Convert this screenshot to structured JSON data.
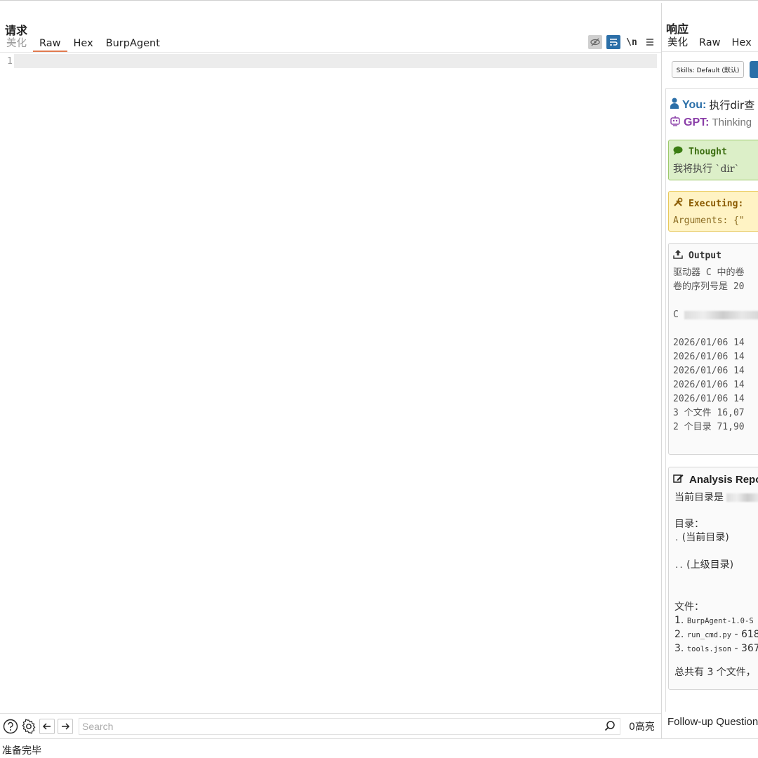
{
  "request": {
    "title": "请求",
    "tabs": [
      {
        "label": "美化",
        "state": "muted"
      },
      {
        "label": "Raw",
        "state": "active"
      },
      {
        "label": "Hex",
        "state": "normal"
      },
      {
        "label": "BurpAgent",
        "state": "normal"
      }
    ],
    "tools": {
      "hide_icon": "eye-slash-icon",
      "wrap_icon": "wrap-text-icon",
      "newline_label": "\\n",
      "menu_icon": "hamburger-menu-icon"
    },
    "editor": {
      "line_number": "1",
      "content": ""
    }
  },
  "search_bar": {
    "help_icon": "question-circle-icon",
    "settings_icon": "gear-icon",
    "back_icon": "arrow-left-icon",
    "forward_icon": "arrow-right-icon",
    "placeholder": "Search",
    "match_count": "0高亮"
  },
  "status": {
    "text": "准备完毕"
  },
  "response": {
    "title": "响应",
    "tabs": [
      {
        "label": "美化",
        "state": "normal"
      },
      {
        "label": "Raw",
        "state": "normal"
      },
      {
        "label": "Hex",
        "state": "normal"
      }
    ],
    "skills_button": "Skills: Default (默认)",
    "chat": {
      "you_label": "You:",
      "you_text": "执行dir查",
      "gpt_label": "GPT:",
      "gpt_text": "Thinking",
      "thought": {
        "title": "Thought",
        "body": "我将执行 `dir`"
      },
      "executing": {
        "title": "Executing:",
        "body": "Arguments: {\""
      },
      "output": {
        "title": "Output",
        "lines": [
          "驱动器 C 中的卷",
          "卷的序列号是 20",
          "",
          "C",
          "",
          "2026/01/06 14",
          "2026/01/06 14",
          "2026/01/06 14",
          "2026/01/06 14",
          "2026/01/06 14",
          "3 个文件 16,07",
          "2 个目录 71,90"
        ]
      },
      "report": {
        "title": "Analysis Repo",
        "current_dir": "当前目录是",
        "dirs_title": "目录：",
        "dir_items": [
          {
            "code": ".",
            "desc": "(当前目录)"
          },
          {
            "code": "..",
            "desc": "(上级目录)"
          }
        ],
        "files_title": "文件：",
        "file_items": [
          {
            "num": "1.",
            "name": "BurpAgent-1.0-S",
            "size": ""
          },
          {
            "num": "2.",
            "name": "run_cmd.py",
            "size": " - 618"
          },
          {
            "num": "3.",
            "name": "tools.json",
            "size": " - 367"
          }
        ],
        "summary": "总共有 3 个文件，"
      },
      "followup_label": "Follow-up Question"
    }
  },
  "colors": {
    "active_tab_underline": "#e07a4f",
    "accent_blue": "#2b6fa8",
    "you_blue": "#2b6fa8",
    "gpt_purple": "#8a3ea8",
    "thought_green": "#dcefc8",
    "exec_yellow": "#fff3c4"
  }
}
